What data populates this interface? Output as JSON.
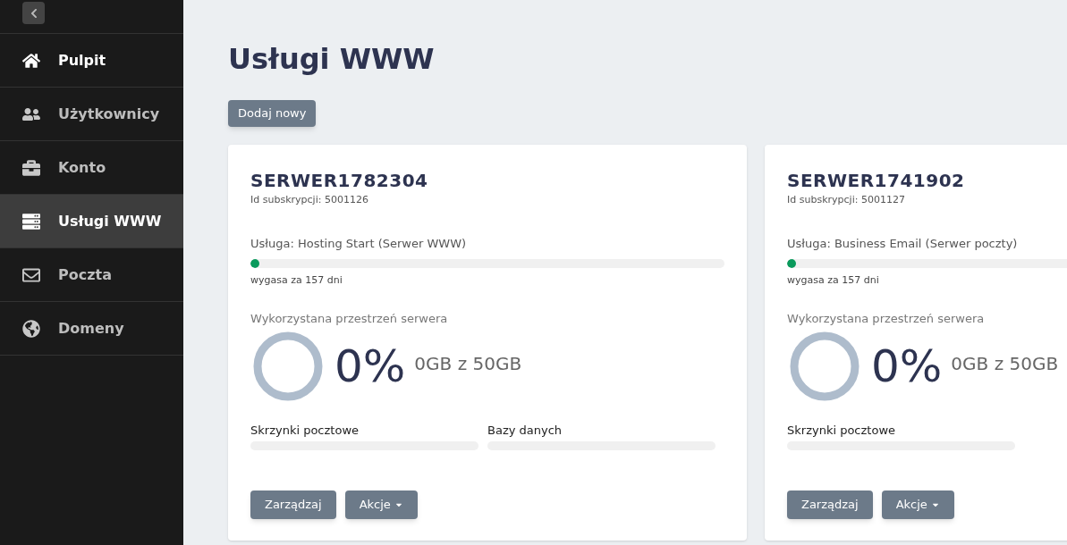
{
  "sidebar": {
    "items": [
      {
        "kind": "home",
        "label": "Pulpit",
        "selected": false
      },
      {
        "kind": "users",
        "label": "Użytkownicy",
        "selected": false
      },
      {
        "kind": "briefcase",
        "label": "Konto",
        "selected": false
      },
      {
        "kind": "server",
        "label": "Usługi WWW",
        "selected": true
      },
      {
        "kind": "mail",
        "label": "Poczta",
        "selected": false
      },
      {
        "kind": "globe",
        "label": "Domeny",
        "selected": false
      }
    ]
  },
  "page": {
    "title": "Usługi WWW",
    "add_button": "Dodaj nowy"
  },
  "cards": [
    {
      "name": "SERWER1782304",
      "subscription": "Id subskrypcji: 5001126",
      "service": "Usługa: Hosting Start (Serwer WWW)",
      "expiry": {
        "level": 0,
        "text": "wygasa za 157 dni"
      },
      "storage": {
        "label": "Wykorzystana przestrzeń serwera",
        "level": 0,
        "percent": "0%",
        "used": "0GB z 50GB"
      },
      "quotas": [
        {
          "label": "Skrzynki pocztowe"
        },
        {
          "label": "Bazy danych"
        }
      ],
      "buttons": {
        "manage": "Zarządzaj",
        "actions": "Akcje"
      }
    },
    {
      "name": "SERWER1741902",
      "subscription": "Id subskrypcji: 5001127",
      "service": "Usługa: Business Email (Serwer poczty)",
      "expiry": {
        "level": 0,
        "text": "wygasa za 157 dni"
      },
      "storage": {
        "label": "Wykorzystana przestrzeń serwera",
        "level": 0,
        "percent": "0%",
        "used": "0GB z 50GB"
      },
      "quotas": [
        {
          "label": "Skrzynki pocztowe"
        }
      ],
      "buttons": {
        "manage": "Zarządzaj",
        "actions": "Akcje"
      }
    }
  ]
}
